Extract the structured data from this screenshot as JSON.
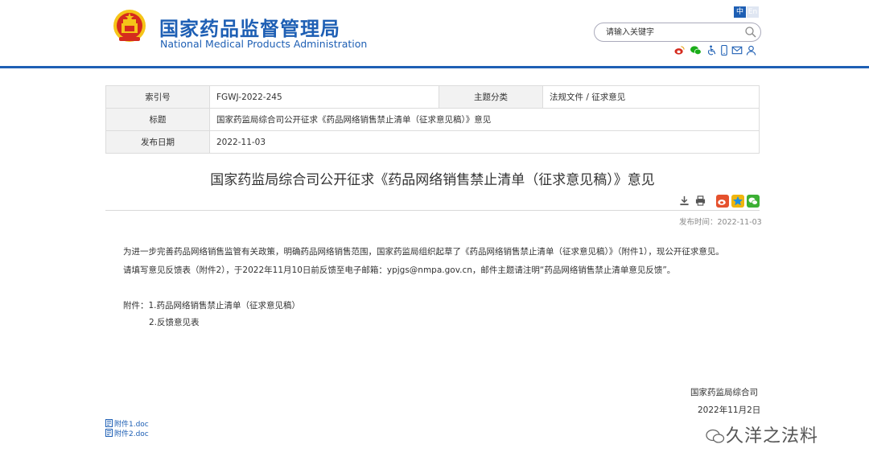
{
  "header": {
    "title_cn": "国家药品监督管理局",
    "title_en": "National Medical Products Administration",
    "lang_zh": "中",
    "lang_en": "En",
    "search_placeholder": "请输入关键字"
  },
  "meta": {
    "index_label": "索引号",
    "index_value": "FGWJ-2022-245",
    "category_label": "主题分类",
    "category_value": "法规文件 / 征求意见",
    "title_label": "标题",
    "title_value": "国家药监局综合司公开征求《药品网络销售禁止清单（征求意见稿）》意见",
    "date_label": "发布日期",
    "date_value": "2022-11-03"
  },
  "article": {
    "title": "国家药监局综合司公开征求《药品网络销售禁止清单（征求意见稿）》意见",
    "publish_time": "发布时间：2022-11-03",
    "para1": "为进一步完善药品网络销售监管有关政策，明确药品网络销售范围，国家药监局组织起草了《药品网络销售禁止清单（征求意见稿）》（附件1），现公开征求意见。",
    "para2": "请填写意见反馈表（附件2），于2022年11月10日前反馈至电子邮箱：ypjgs@nmpa.gov.cn，邮件主题请注明“药品网络销售禁止清单意见反馈”。",
    "attach1": "附件：1.药品网络销售禁止清单（征求意见稿）",
    "attach2": "2.反馈意见表",
    "signature": "国家药监局综合司",
    "sign_date": "2022年11月2日",
    "download1": "附件1.doc",
    "download2": "附件2.doc"
  },
  "watermark": "久洋之法料",
  "colors": {
    "brand_blue": "#1e5fb4",
    "emblem_red": "#d52b1e",
    "emblem_gold": "#f5c518"
  }
}
